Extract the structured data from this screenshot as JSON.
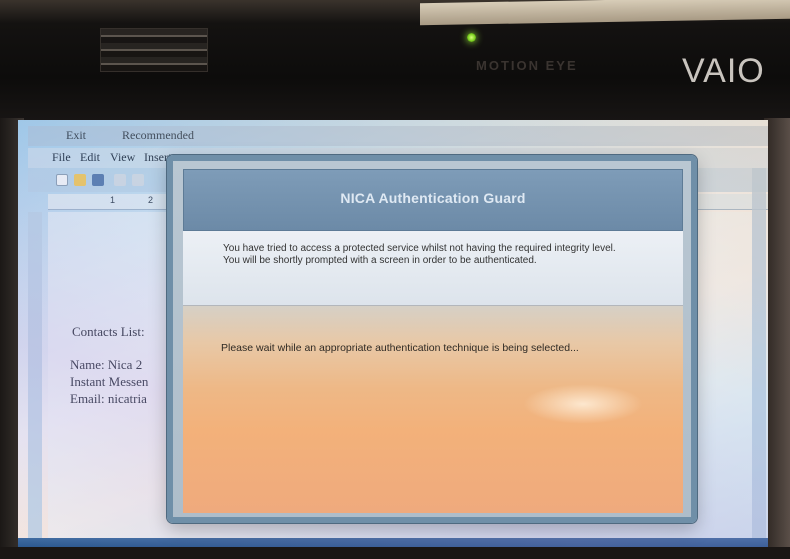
{
  "laptop": {
    "camera_label": "MOTION EYE",
    "brand": "VAIO"
  },
  "word": {
    "title_fragments": [
      "Exit",
      "Recommended"
    ],
    "menu": [
      "File",
      "Edit",
      "View",
      "Insert"
    ],
    "ruler_ticks": [
      "1",
      "2"
    ],
    "document": {
      "heading": "Contacts List:",
      "name_line": "Name: Nica 2",
      "im_line": "Instant Messen",
      "email_line": "Email: nicatria"
    }
  },
  "dialog": {
    "title": "NICA Authentication Guard",
    "message": "You have tried to access a protected service whilst not having the required integrity level. You will be shortly prompted with a screen in order to be authenticated.",
    "wait_text": "Please wait while an appropriate authentication technique is being selected..."
  }
}
